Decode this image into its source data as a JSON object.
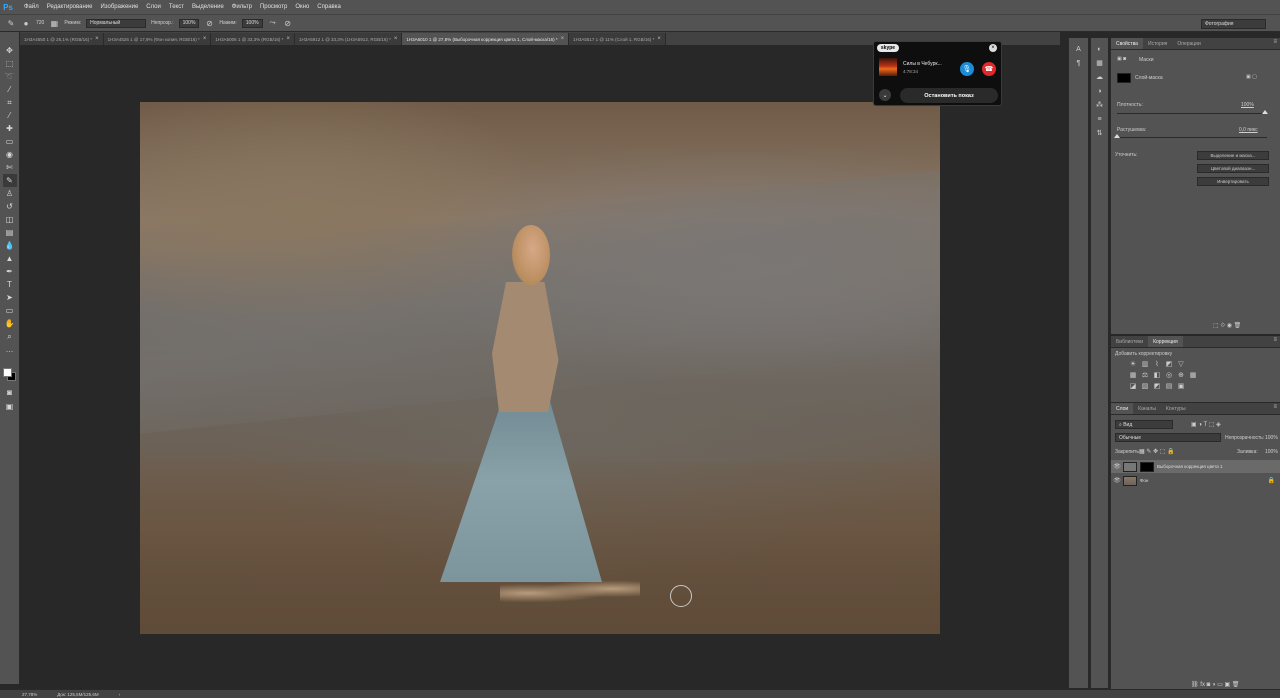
{
  "app": {
    "logo": "Ps"
  },
  "menu": [
    "Файл",
    "Редактирование",
    "Изображение",
    "Слои",
    "Текст",
    "Выделение",
    "Фильтр",
    "Просмотр",
    "Окно",
    "Справка"
  ],
  "options": {
    "brush_size": "720",
    "mode_label": "Режим:",
    "mode_value": "Нормальный",
    "opacity_label": "Непрозр.:",
    "opacity_value": "100%",
    "flow_label": "Нажим:",
    "flow_value": "100%",
    "workspace": "Фотография"
  },
  "tabs": [
    {
      "label": "1H3A4550 1 @ 25,1% (RGB/16) *",
      "active": false
    },
    {
      "label": "1H3A4526 1 @ 17,9% (Фон копия, RGB/16) *",
      "active": false
    },
    {
      "label": "1H3A5006 1 @ 33,3% (RGB/16) *",
      "active": false
    },
    {
      "label": "1H3A5912 1 @ 33,3% (1H3A5912, RGB/16) *",
      "active": false
    },
    {
      "label": "1H3A6010 1 @ 27,8% (Выборочная коррекция цвета 1, Слой-маска/16) *",
      "active": true
    },
    {
      "label": "1H3A5517 1 @ 11% (Слой 1, RGB/16) *",
      "active": false
    }
  ],
  "skype": {
    "logo": "skype",
    "caller": "Силы в Чебурк...",
    "duration": "4:78:34",
    "stop_label": "Остановить показ"
  },
  "properties": {
    "tabs": [
      "Свойства",
      "История",
      "Операции"
    ],
    "section": "Маски",
    "layer_mask_label": "Слой-маска",
    "density_label": "Плотность:",
    "density_value": "100%",
    "feather_label": "Растушевка:",
    "feather_value": "0,0 пикс",
    "refine_label": "Уточнить:",
    "btn_select_mask": "Выделение и маска...",
    "btn_color_range": "Цветовой диапазон...",
    "btn_invert": "Инвертировать"
  },
  "adjustments": {
    "tabs": [
      "Библиотеки",
      "Коррекция"
    ],
    "title": "Добавить корректировку"
  },
  "layers": {
    "tabs": [
      "Слои",
      "Каналы",
      "Контуры"
    ],
    "filter_label": "Вид",
    "blend_mode": "Обычные",
    "opacity_label": "Непрозрачность:",
    "opacity_value": "100%",
    "lock_label": "Закрепить:",
    "fill_label": "Заливка:",
    "fill_value": "100%",
    "items": [
      {
        "name": "Выборочная коррекция цвета 1",
        "selected": true
      },
      {
        "name": "Фон",
        "selected": false
      }
    ]
  },
  "status": {
    "zoom": "27,78%",
    "doc_size": "Док: 125,6M/125,6M"
  }
}
